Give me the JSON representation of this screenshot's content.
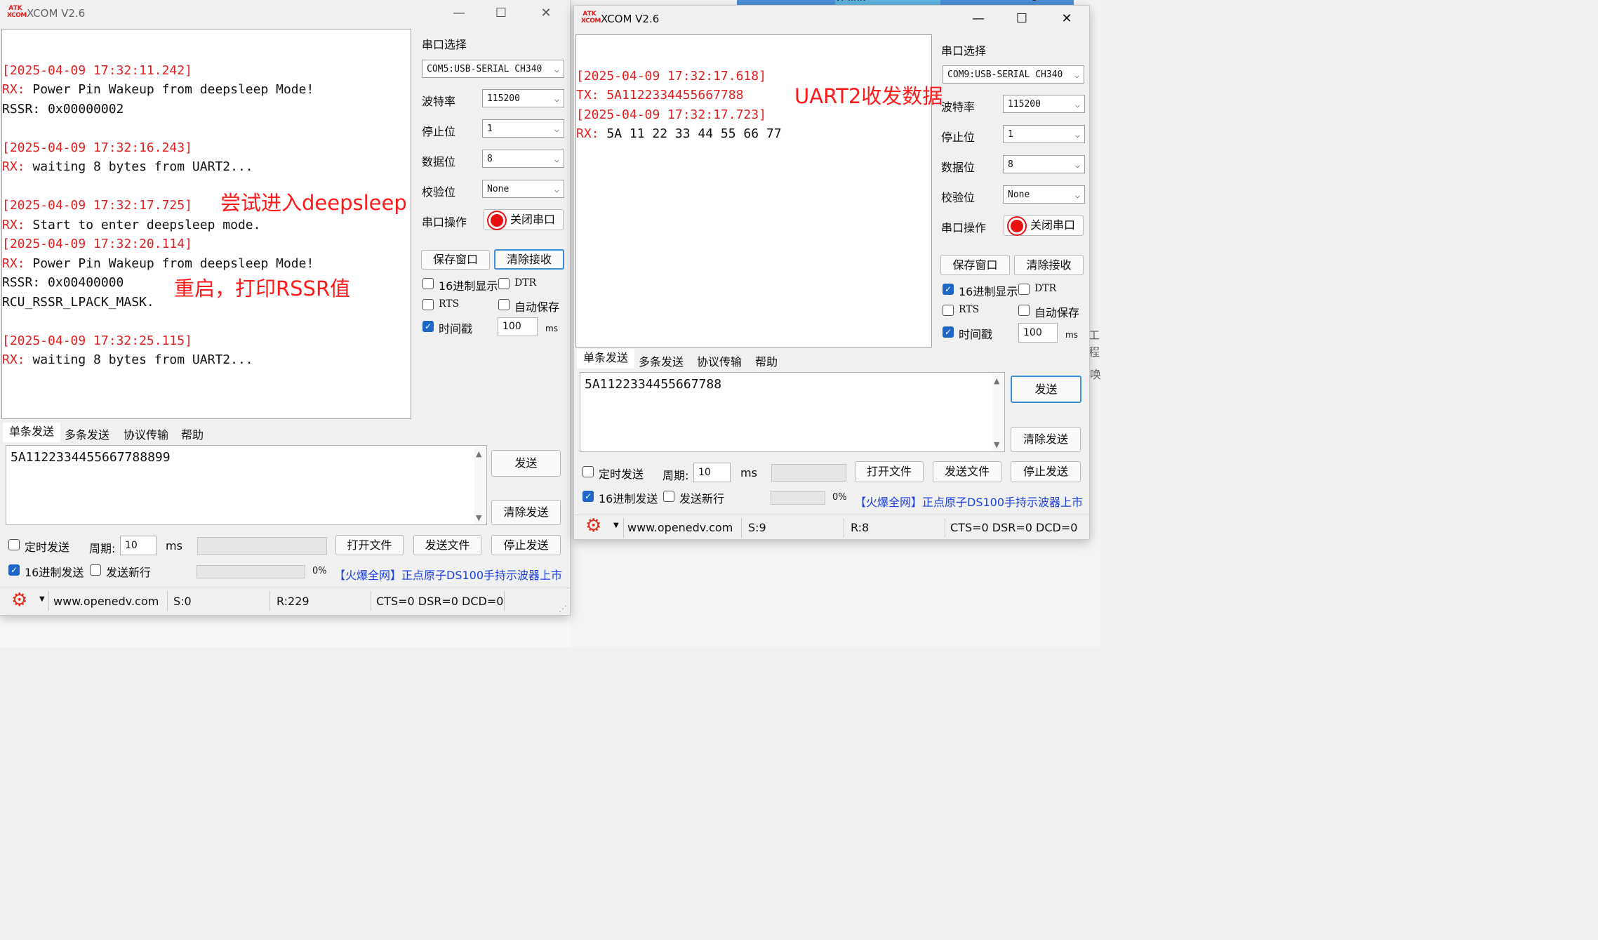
{
  "app": {
    "title": "XCOM V2.6",
    "logo_top": "ATK",
    "logo_bottom": "XCOM"
  },
  "window_controls": {
    "minimize": "—",
    "maximize": "☐",
    "close": "✕"
  },
  "background": {
    "tab_labels": [
      "vr-link",
      "5"
    ],
    "right_edge_texts": [
      "工程",
      "唤"
    ]
  },
  "left": {
    "recv_lines": [
      {
        "text": "",
        "cls": ""
      },
      {
        "text": "[2025-04-09 17:32:11.242]",
        "cls": "red"
      },
      {
        "text": "RX: Power Pin Wakeup from deepsleep Mode!",
        "cls": "rx"
      },
      {
        "text": "RSSR: 0x00000002",
        "cls": ""
      },
      {
        "text": "",
        "cls": ""
      },
      {
        "text": "[2025-04-09 17:32:16.243]",
        "cls": "red"
      },
      {
        "text": "RX: waiting 8 bytes from UART2...",
        "cls": "rx"
      },
      {
        "text": "",
        "cls": ""
      },
      {
        "text": "[2025-04-09 17:32:17.725]",
        "cls": "red"
      },
      {
        "text": "RX: Start to enter deepsleep mode.",
        "cls": "rx"
      },
      {
        "text": "[2025-04-09 17:32:20.114]",
        "cls": "red"
      },
      {
        "text": "RX: Power Pin Wakeup from deepsleep Mode!",
        "cls": "rx"
      },
      {
        "text": "RSSR: 0x00400000",
        "cls": ""
      },
      {
        "text": "RCU_RSSR_LPACK_MASK.",
        "cls": ""
      },
      {
        "text": "",
        "cls": ""
      },
      {
        "text": "[2025-04-09 17:32:25.115]",
        "cls": "red"
      },
      {
        "text": "RX: waiting 8 bytes from UART2...",
        "cls": "rx"
      }
    ],
    "annotations": {
      "deepsleep": "尝试进入deepsleep",
      "restart": "重启，打印RSSR值"
    },
    "settings": {
      "port_label": "串口选择",
      "port_value": "COM5:USB-SERIAL CH340",
      "baud_label": "波特率",
      "baud_value": "115200",
      "stop_label": "停止位",
      "stop_value": "1",
      "data_label": "数据位",
      "data_value": "8",
      "parity_label": "校验位",
      "parity_value": "None",
      "op_label": "串口操作",
      "op_button": "关闭串口"
    },
    "buttons": {
      "save_window": "保存窗口",
      "clear_recv": "清除接收"
    },
    "options": {
      "hex_display": "16进制显示",
      "hex_display_checked": false,
      "dtr": "DTR",
      "dtr_checked": false,
      "rts": "RTS",
      "rts_checked": false,
      "auto_save": "自动保存",
      "auto_save_checked": false,
      "timestamp": "时间戳",
      "timestamp_checked": true,
      "timestamp_value": "100",
      "timestamp_unit": "ms"
    },
    "tabs": [
      "单条发送",
      "多条发送",
      "协议传输",
      "帮助"
    ],
    "send_text": "5A1122334455667788899",
    "send_button": "发送",
    "clear_send_button": "清除发送",
    "timed_send": "定时发送",
    "timed_send_checked": false,
    "period_label": "周期:",
    "period_value": "10",
    "period_unit": "ms",
    "open_file": "打开文件",
    "send_file": "发送文件",
    "stop_send": "停止发送",
    "hex_send": "16进制发送",
    "hex_send_checked": true,
    "send_newline": "发送新行",
    "send_newline_checked": false,
    "progress": "0%",
    "ad_text": "【火爆全网】正点原子DS100手持示波器上市",
    "status": {
      "website": "www.openedv.com",
      "sent": "S:0",
      "recv": "R:229",
      "lines": "CTS=0 DSR=0 DCD=0"
    }
  },
  "right": {
    "recv_lines": [
      {
        "text": "",
        "cls": ""
      },
      {
        "text": "[2025-04-09 17:32:17.618]",
        "cls": "red"
      },
      {
        "text": "TX: 5A1122334455667788",
        "cls": "red"
      },
      {
        "text": "[2025-04-09 17:32:17.723]",
        "cls": "red"
      },
      {
        "text": "RX: 5A 11 22 33 44 55 66 77",
        "cls": "rx"
      }
    ],
    "annotation": "UART2收发数据",
    "settings": {
      "port_label": "串口选择",
      "port_value": "COM9:USB-SERIAL CH340",
      "baud_label": "波特率",
      "baud_value": "115200",
      "stop_label": "停止位",
      "stop_value": "1",
      "data_label": "数据位",
      "data_value": "8",
      "parity_label": "校验位",
      "parity_value": "None",
      "op_label": "串口操作",
      "op_button": "关闭串口"
    },
    "buttons": {
      "save_window": "保存窗口",
      "clear_recv": "清除接收"
    },
    "options": {
      "hex_display": "16进制显示",
      "hex_display_checked": true,
      "dtr": "DTR",
      "dtr_checked": false,
      "rts": "RTS",
      "rts_checked": false,
      "auto_save": "自动保存",
      "auto_save_checked": false,
      "timestamp": "时间戳",
      "timestamp_checked": true,
      "timestamp_value": "100",
      "timestamp_unit": "ms"
    },
    "tabs": [
      "单条发送",
      "多条发送",
      "协议传输",
      "帮助"
    ],
    "send_text": "5A1122334455667788",
    "send_button": "发送",
    "clear_send_button": "清除发送",
    "timed_send": "定时发送",
    "timed_send_checked": false,
    "period_label": "周期:",
    "period_value": "10",
    "period_unit": "ms",
    "open_file": "打开文件",
    "send_file": "发送文件",
    "stop_send": "停止发送",
    "hex_send": "16进制发送",
    "hex_send_checked": true,
    "send_newline": "发送新行",
    "send_newline_checked": false,
    "progress": "0%",
    "ad_text": "【火爆全网】正点原子DS100手持示波器上市",
    "status": {
      "website": "www.openedv.com",
      "sent": "S:9",
      "recv": "R:8",
      "lines": "CTS=0 DSR=0 DCD=0"
    }
  }
}
